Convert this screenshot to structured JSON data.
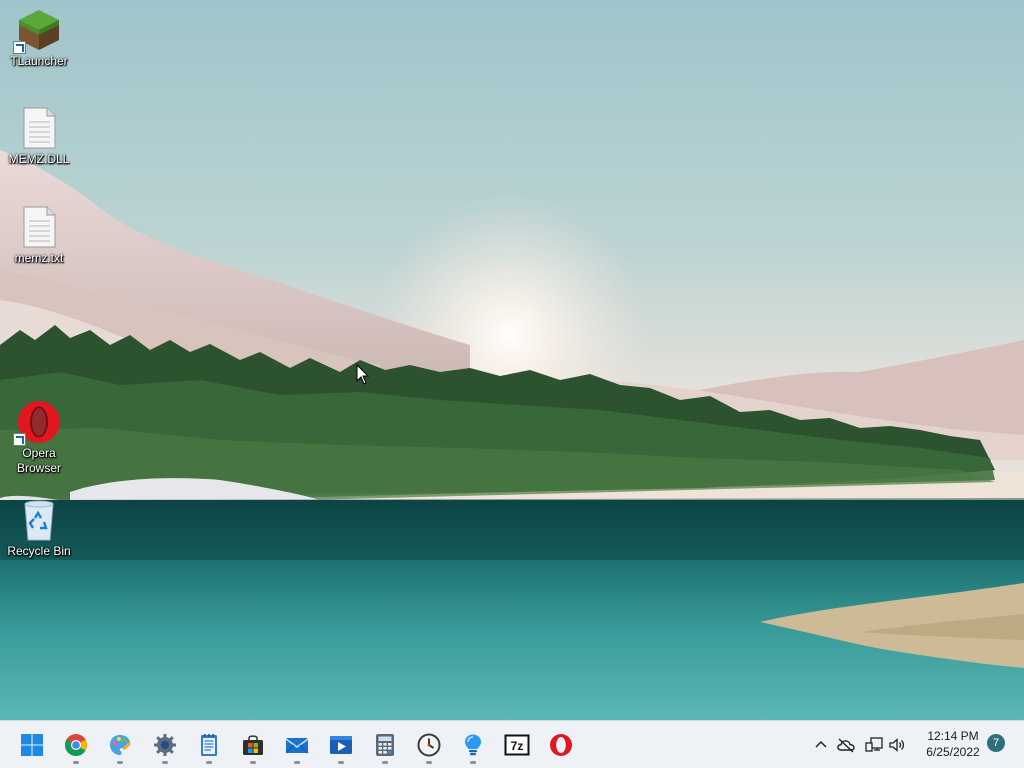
{
  "desktop": {
    "icons": [
      {
        "label": "TLauncher",
        "icon": "minecraft-grass-block-icon",
        "shortcut": true
      },
      {
        "label": "MEMZ.DLL",
        "icon": "document-file-icon",
        "shortcut": false
      },
      {
        "label": "memz.txt",
        "icon": "text-file-icon",
        "shortcut": false
      },
      {
        "label": "Opera\nBrowser",
        "icon": "opera-icon",
        "shortcut": true
      },
      {
        "label": "Recycle Bin",
        "icon": "recycle-bin-icon",
        "shortcut": false
      }
    ]
  },
  "taskbar": {
    "apps": [
      {
        "name": "Start",
        "icon": "windows-start-icon",
        "running": false
      },
      {
        "name": "Google Chrome",
        "icon": "chrome-icon",
        "running": true
      },
      {
        "name": "Paint",
        "icon": "paint-icon",
        "running": true
      },
      {
        "name": "Settings",
        "icon": "gear-icon",
        "running": true
      },
      {
        "name": "Notepad",
        "icon": "notepad-icon",
        "running": true
      },
      {
        "name": "Microsoft Store",
        "icon": "store-icon",
        "running": true
      },
      {
        "name": "Mail",
        "icon": "mail-icon",
        "running": true
      },
      {
        "name": "Movies & TV",
        "icon": "video-icon",
        "running": true
      },
      {
        "name": "Calculator",
        "icon": "calculator-icon",
        "running": true
      },
      {
        "name": "Clock",
        "icon": "clock-icon",
        "running": true
      },
      {
        "name": "Tips",
        "icon": "lightbulb-icon",
        "running": true
      },
      {
        "name": "7-Zip",
        "icon": "7zip-icon",
        "running": false
      },
      {
        "name": "Opera",
        "icon": "opera-icon",
        "running": false
      }
    ],
    "tray": {
      "overflow_icon": "chevron-up-icon",
      "onedrive_icon": "cloud-offline-icon",
      "network_icon": "network-icon",
      "volume_icon": "speaker-icon",
      "time": "12:14 PM",
      "date": "6/25/2022",
      "notification_count": "7"
    }
  }
}
